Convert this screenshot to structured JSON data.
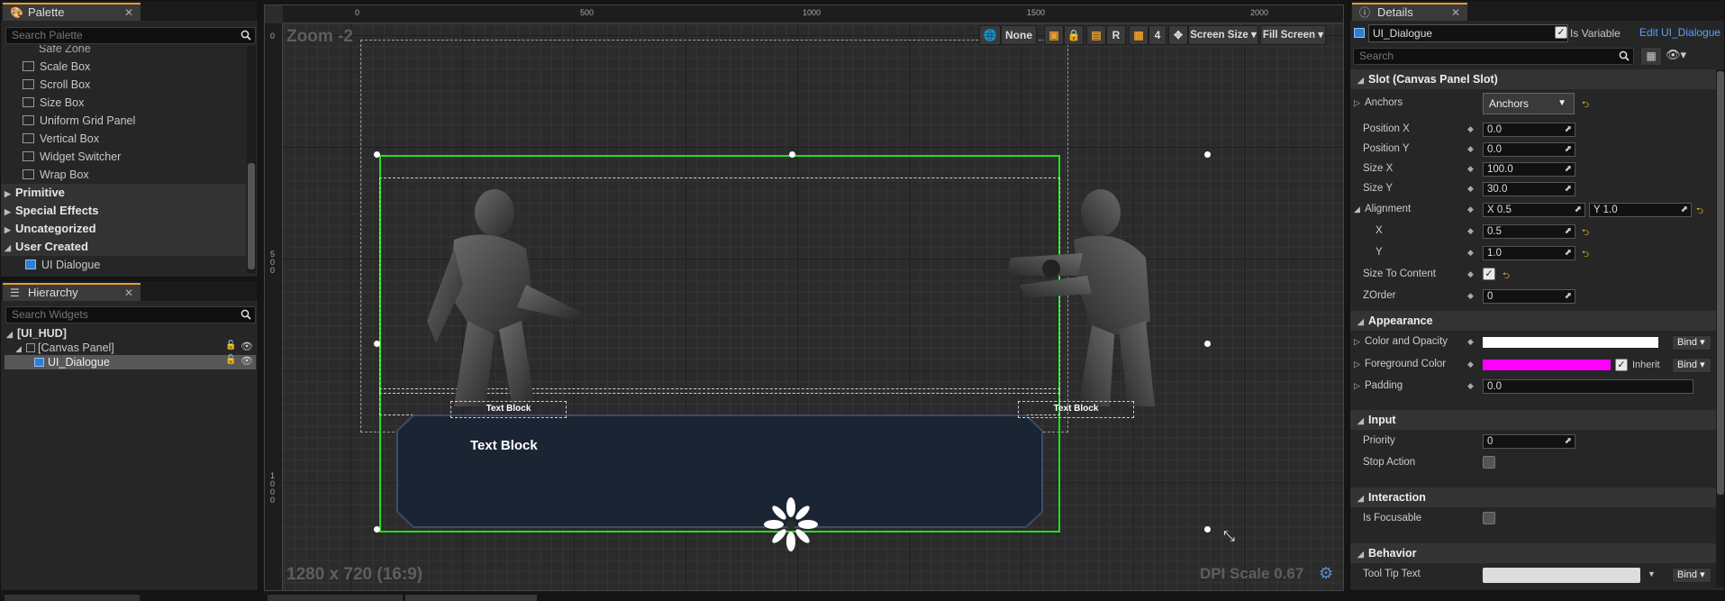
{
  "palette": {
    "tab_label": "Palette",
    "search_placeholder": "Search Palette",
    "partial_item": "Safe Zone",
    "items": [
      "Scale Box",
      "Scroll Box",
      "Size Box",
      "Uniform Grid Panel",
      "Vertical Box",
      "Widget Switcher",
      "Wrap Box"
    ],
    "categories": [
      "Primitive",
      "Special Effects",
      "Uncategorized",
      "User Created"
    ],
    "user_item": "UI Dialogue"
  },
  "hierarchy": {
    "tab_label": "Hierarchy",
    "search_placeholder": "Search Widgets",
    "root": "[UI_HUD]",
    "canvas_panel": "[Canvas Panel]",
    "selected": "UI_Dialogue"
  },
  "designer": {
    "zoom_label": "Zoom -2",
    "resolution_label": "1280 x 720 (16:9)",
    "dpi_label": "DPI Scale 0.67",
    "ruler_top": [
      "0",
      "500",
      "1000",
      "1500",
      "2000"
    ],
    "ruler_left": [
      "0",
      "5\n0\n0",
      "1\n0\n0\n0"
    ],
    "toolbar": {
      "none_label": "None",
      "r_label": "R",
      "four_label": "4",
      "screen_size": "Screen Size",
      "fill_screen": "Fill Screen"
    },
    "text_blocks": {
      "left_small": "Text Block",
      "right_small": "Text Block",
      "main": "Text Block"
    }
  },
  "details": {
    "tab_label": "Details",
    "widget_name": "UI_Dialogue",
    "is_variable_label": "Is Variable",
    "edit_link": "Edit UI_Dialogue",
    "search_placeholder": "Search",
    "sections": {
      "slot": "Slot (Canvas Panel Slot)",
      "appearance": "Appearance",
      "input": "Input",
      "interaction": "Interaction",
      "behavior": "Behavior"
    },
    "slot": {
      "anchors_label": "Anchors",
      "anchors_value": "Anchors",
      "position_x_label": "Position X",
      "position_x": "0.0",
      "position_y_label": "Position Y",
      "position_y": "0.0",
      "size_x_label": "Size X",
      "size_x": "100.0",
      "size_y_label": "Size Y",
      "size_y": "30.0",
      "alignment_label": "Alignment",
      "alignment_x": "X  0.5",
      "alignment_y": "Y  1.0",
      "x_label": "X",
      "x_value": "0.5",
      "y_label": "Y",
      "y_value": "1.0",
      "size_to_content_label": "Size To Content",
      "zorder_label": "ZOrder",
      "zorder": "0"
    },
    "appearance": {
      "color_opacity_label": "Color and Opacity",
      "foreground_label": "Foreground Color",
      "inherit_label": "Inherit",
      "padding_label": "Padding",
      "padding": "0.0",
      "bind_label": "Bind",
      "color_white": "#ffffff",
      "color_magenta": "#ff00ff"
    },
    "input": {
      "priority_label": "Priority",
      "priority": "0",
      "stop_action_label": "Stop Action"
    },
    "interaction": {
      "is_focusable_label": "Is Focusable"
    },
    "behavior": {
      "tooltip_label": "Tool Tip Text"
    }
  },
  "colors": {
    "accent": "#e69b2e",
    "selection_green": "#22dd22",
    "dialogue_bg": "#1b2432"
  }
}
